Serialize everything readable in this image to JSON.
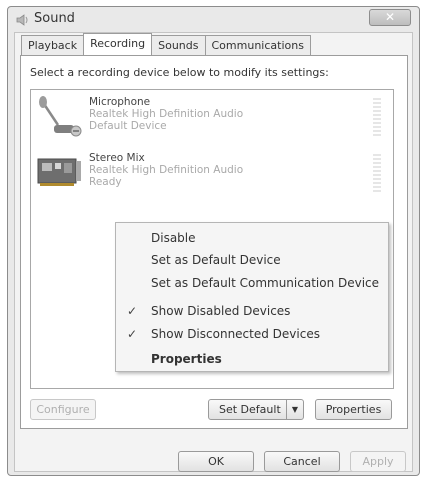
{
  "window": {
    "title": "Sound",
    "close_label": "✕"
  },
  "tabs": [
    {
      "label": "Playback"
    },
    {
      "label": "Recording"
    },
    {
      "label": "Sounds"
    },
    {
      "label": "Communications"
    }
  ],
  "active_tab": "Recording",
  "instruction": "Select a recording device below to modify its settings:",
  "devices": [
    {
      "name": "Microphone",
      "description": "Realtek High Definition Audio",
      "status": "Default Device"
    },
    {
      "name": "Stereo Mix",
      "description": "Realtek High Definition Audio",
      "status": "Ready"
    }
  ],
  "context_menu": {
    "items": [
      {
        "label": "Disable",
        "checked": false,
        "bold": false
      },
      {
        "label": "Set as Default Device",
        "checked": false,
        "bold": false
      },
      {
        "label": "Set as Default Communication Device",
        "checked": false,
        "bold": false
      },
      {
        "label": "Show Disabled Devices",
        "checked": true,
        "bold": false
      },
      {
        "label": "Show Disconnected Devices",
        "checked": true,
        "bold": false
      },
      {
        "label": "Properties",
        "checked": false,
        "bold": true
      }
    ],
    "check_glyph": "✓"
  },
  "panel_buttons": {
    "configure": "Configure",
    "set_default": "Set Default",
    "set_default_arrow": "▼",
    "properties": "Properties"
  },
  "dialog_buttons": {
    "ok": "OK",
    "cancel": "Cancel",
    "apply": "Apply"
  },
  "icons": {
    "title": "speaker-icon",
    "microphone": "microphone-icon",
    "stereo_mix": "sound-card-icon"
  }
}
